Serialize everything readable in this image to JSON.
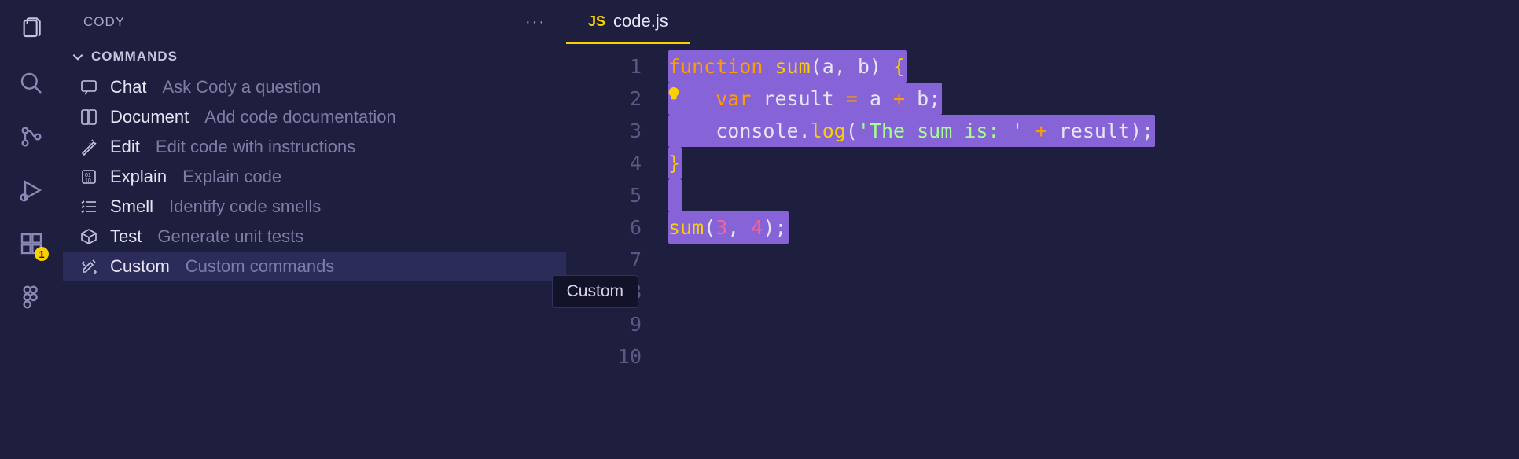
{
  "sidebar": {
    "title": "CODY",
    "section": "COMMANDS",
    "commands": [
      {
        "label": "Chat",
        "desc": "Ask Cody a question"
      },
      {
        "label": "Document",
        "desc": "Add code documentation"
      },
      {
        "label": "Edit",
        "desc": "Edit code with instructions"
      },
      {
        "label": "Explain",
        "desc": "Explain code"
      },
      {
        "label": "Smell",
        "desc": "Identify code smells"
      },
      {
        "label": "Test",
        "desc": "Generate unit tests"
      },
      {
        "label": "Custom",
        "desc": "Custom commands"
      }
    ],
    "tooltip": "Custom"
  },
  "activity": {
    "badge": "1"
  },
  "tab": {
    "lang": "JS",
    "filename": "code.js"
  },
  "code": {
    "lines": [
      "1",
      "2",
      "3",
      "4",
      "5",
      "6",
      "7",
      "8",
      "9",
      "10"
    ],
    "l1": {
      "kw": "function",
      "fn": " sum",
      "args": "(a, b) ",
      "brace": "{"
    },
    "l2": {
      "indent": "    ",
      "kw": "var",
      "id": " result ",
      "op": "=",
      "rhs": " a ",
      "op2": "+",
      "rhs2": " b",
      "semi": ";"
    },
    "l3": {
      "indent": "    ",
      "obj": "console",
      "dot": ".",
      "method": "log",
      "open": "(",
      "str": "'The sum is: '",
      "plus": " + ",
      "id": "result",
      "close": ")",
      "semi": ";"
    },
    "l4": {
      "brace": "}"
    },
    "l6": {
      "fn": "sum",
      "open": "(",
      "n1": "3",
      "comma": ", ",
      "n2": "4",
      "close": ")",
      "semi": ";"
    }
  }
}
